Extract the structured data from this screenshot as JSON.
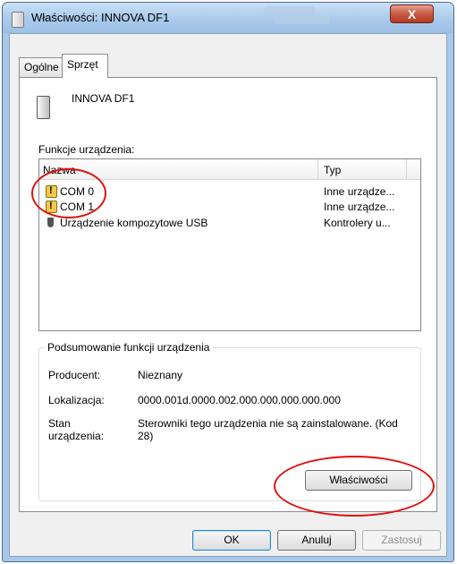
{
  "window": {
    "title": "Właściwości: INNOVA DF1",
    "close_glyph": "X",
    "icon": "device-icon"
  },
  "tabs": [
    {
      "label": "Ogólne",
      "active": false
    },
    {
      "label": "Sprzęt",
      "active": true
    }
  ],
  "device": {
    "name": "INNOVA DF1",
    "icon": "tower-device-icon"
  },
  "functions": {
    "label": "Funkcje urządzenia:",
    "columns": {
      "name": "Nazwa",
      "type": "Typ"
    },
    "rows": [
      {
        "name": "COM 0",
        "type": "Inne urządze...",
        "icon": "warning-device-icon"
      },
      {
        "name": "COM 1",
        "type": "Inne urządze...",
        "icon": "warning-device-icon"
      },
      {
        "name": "Urządzenie kompozytowe USB",
        "type": "Kontrolery u...",
        "icon": "usb-icon"
      }
    ]
  },
  "summary": {
    "legend": "Podsumowanie funkcji urządzenia",
    "manufacturer_label": "Producent:",
    "manufacturer_value": "Nieznany",
    "location_label": "Lokalizacja:",
    "location_value": "0000.001d.0000.002.000.000.000.000.000",
    "status_label": "Stan urządzenia:",
    "status_value": "Sterowniki tego urządzenia nie są zainstalowane. (Kod 28)",
    "properties_button": "Właściwości"
  },
  "footer": {
    "ok": "OK",
    "cancel": "Anuluj",
    "apply": "Zastosuj"
  },
  "annotation": {
    "color": "#e01010"
  }
}
